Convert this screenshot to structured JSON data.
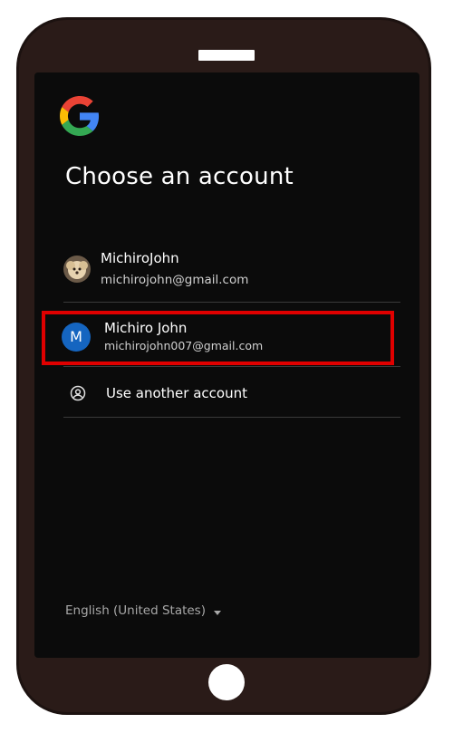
{
  "header": {
    "title": "Choose an account"
  },
  "accounts": [
    {
      "name": "MichiroJohn",
      "email": "michirojohn@gmail.com",
      "avatar": "photo-dog-icon"
    },
    {
      "name": "Michiro John",
      "email": "michirojohn007@gmail.com",
      "avatar_letter": "M",
      "avatar_color": "#1565c0",
      "highlighted": true
    }
  ],
  "another": {
    "label": "Use another account",
    "icon": "account-circle-icon"
  },
  "footer": {
    "language": "English (United States)"
  },
  "colors": {
    "highlight": "#e00000",
    "screen_bg": "#0b0b0b",
    "phone_body": "#2a1b18"
  }
}
